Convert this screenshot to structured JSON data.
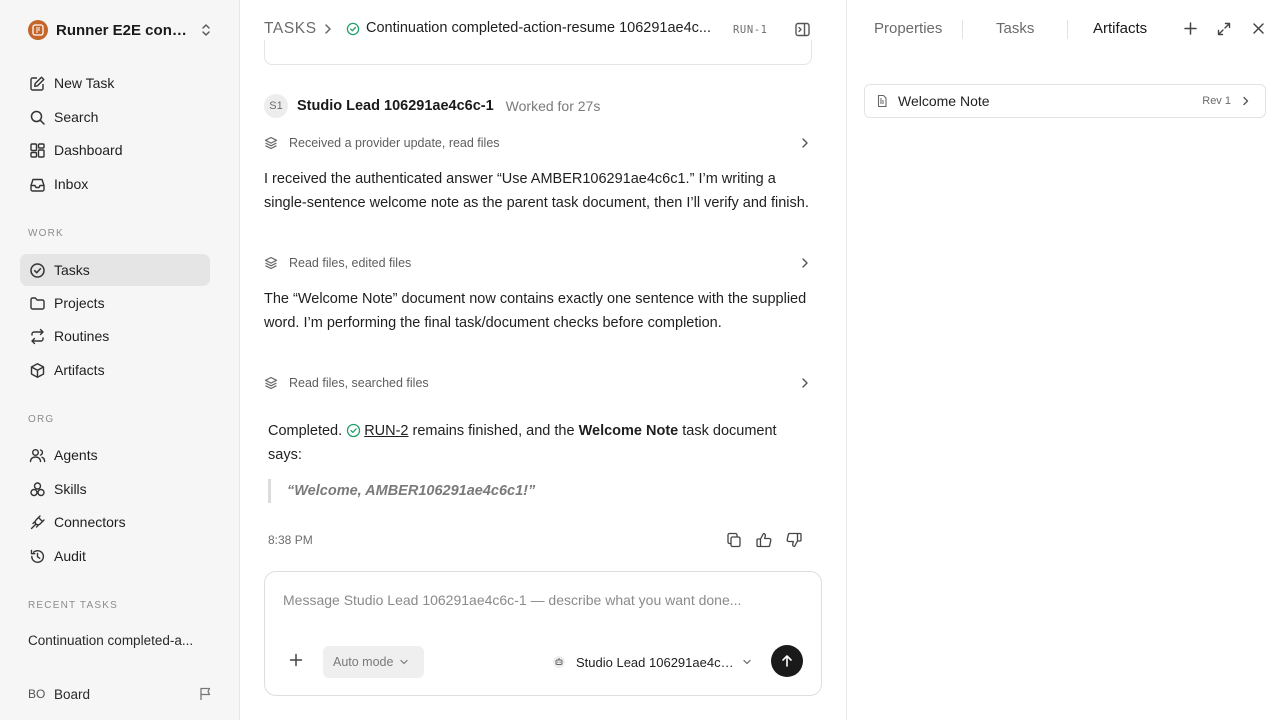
{
  "workspace": {
    "name": "Runner E2E conti..."
  },
  "sidebar": {
    "main_items": [
      {
        "label": "New Task",
        "icon": "edit-icon"
      },
      {
        "label": "Search",
        "icon": "search-icon"
      },
      {
        "label": "Dashboard",
        "icon": "dashboard-icon"
      },
      {
        "label": "Inbox",
        "icon": "inbox-icon"
      }
    ],
    "work_label": "WORK",
    "work_items": [
      {
        "label": "Tasks",
        "icon": "check-circle-icon",
        "active": true
      },
      {
        "label": "Projects",
        "icon": "folder-icon"
      },
      {
        "label": "Routines",
        "icon": "repeat-icon"
      },
      {
        "label": "Artifacts",
        "icon": "box-icon"
      }
    ],
    "org_label": "ORG",
    "org_items": [
      {
        "label": "Agents",
        "icon": "users-icon"
      },
      {
        "label": "Skills",
        "icon": "skills-icon"
      },
      {
        "label": "Connectors",
        "icon": "plug-icon"
      },
      {
        "label": "Audit",
        "icon": "history-icon"
      }
    ],
    "recent_label": "RECENT TASKS",
    "recent_items": [
      "Continuation completed-a..."
    ],
    "user": {
      "initials": "BO",
      "name": "Board"
    }
  },
  "header": {
    "root": "TASKS",
    "title": "Continuation completed-action-resume 106291ae4c...",
    "task_id": "RUN-1",
    "status_color": "#22a06b"
  },
  "thread": {
    "agent_initials": "S1",
    "agent_name": "Studio Lead 106291ae4c6c-1",
    "worked": "Worked for 27s",
    "steps": [
      {
        "tool_summary": "Received a provider update, read files",
        "message": "I received the authenticated answer “Use AMBER106291ae4c6c1.” I’m writing a single-sentence welcome note as the parent task document, then I’ll verify and finish."
      },
      {
        "tool_summary": "Read files, edited files",
        "message": "The “Welcome Note” document now contains exactly one sentence with the supplied word. I’m performing the final task/document checks before completion."
      },
      {
        "tool_summary": "Read files, searched files"
      }
    ],
    "final": {
      "lead": "Completed.",
      "link": "RUN-2",
      "mid": "remains finished, and the",
      "bold": "Welcome Note",
      "tail": "task document says:",
      "quote": "“Welcome, AMBER106291ae4c6c1!”"
    },
    "timestamp": "8:38 PM"
  },
  "composer": {
    "placeholder": "Message Studio Lead 106291ae4c6c-1 — describe what you want done...",
    "mode": "Auto mode",
    "agent": "Studio Lead 106291ae4c6..."
  },
  "right_panel": {
    "tabs": [
      "Properties",
      "Tasks",
      "Artifacts"
    ],
    "active_tab": "Artifacts",
    "artifacts": [
      {
        "title": "Welcome Note",
        "rev": "Rev 1"
      }
    ]
  }
}
